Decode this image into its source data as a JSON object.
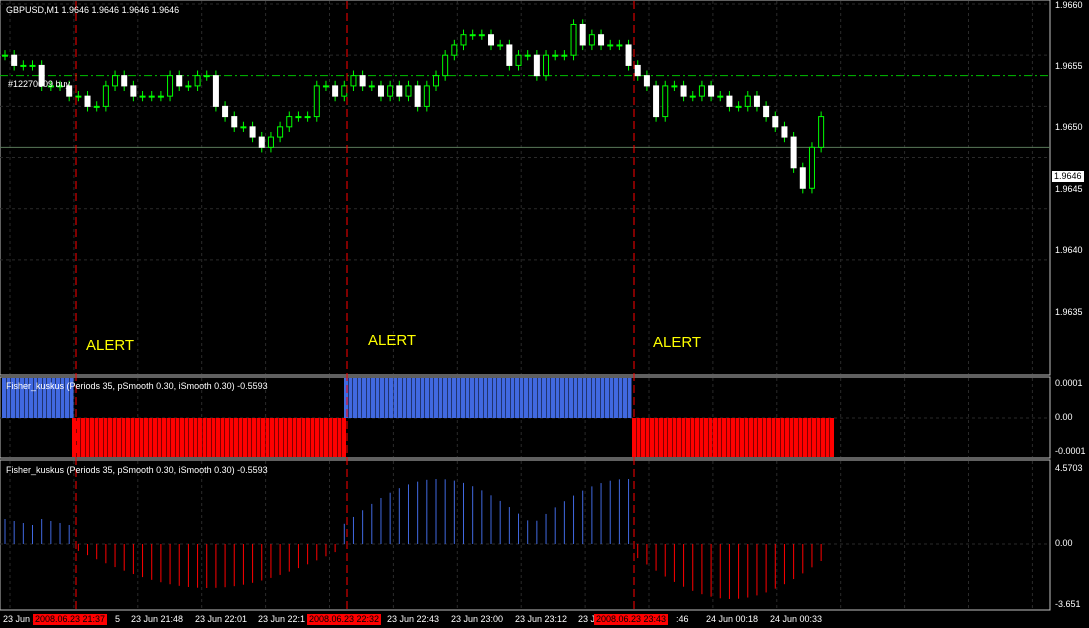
{
  "window": {
    "title": "GBPUSD,M1  1.9646 1.9646 1.9646 1.9646"
  },
  "order_label": "#12270609 buy",
  "alerts": [
    "ALERT",
    "ALERT",
    "ALERT"
  ],
  "price_axis": {
    "labels": [
      "1.9660",
      "1.9655",
      "1.9650",
      "1.9645",
      "1.9640",
      "1.9635"
    ],
    "current": "1.9646"
  },
  "ind1": {
    "title": "Fisher_kuskus  (Periods 35, pSmooth 0.30, iSmooth 0.30)  -0.5593",
    "axis": [
      "0.0001",
      "0.00",
      "-0.0001"
    ]
  },
  "ind2": {
    "title": "Fisher_kuskus  (Periods 35, pSmooth 0.30, iSmooth 0.30)  -0.5593",
    "axis": [
      "4.5703",
      "0.00",
      "-3.651"
    ]
  },
  "time_axis": {
    "labels": [
      "23 Jun 2",
      "5",
      "23 Jun 21:48",
      "23 Jun 22:01",
      "23 Jun 22:1",
      "23 Jun 22:43",
      "23 Jun 23:00",
      "23 Jun 23:12",
      "23 J",
      ":46",
      "24 Jun 00:18",
      "24 Jun 00:33"
    ],
    "markers": [
      "2008.06.23 21:37",
      "2008.06.23 22:32",
      "2008.06.23 23:43"
    ]
  },
  "colors": {
    "bull": "#00ff00",
    "bear": "#ffffff",
    "up": "#4169e1",
    "down": "#ff0000",
    "alert": "#ffff00",
    "grid": "#2a2a2a",
    "vline": "#ff0000"
  },
  "chart_data": {
    "type": "candlestick",
    "symbol": "GBPUSD",
    "timeframe": "M1",
    "price_range": [
      1.963,
      1.966
    ],
    "current_price": 1.9646,
    "order_price": 1.9653,
    "close_series": [
      1.9655,
      1.9654,
      1.9654,
      1.9654,
      1.9652,
      1.9652,
      1.9652,
      1.9651,
      1.9651,
      1.965,
      1.965,
      1.9652,
      1.9653,
      1.9652,
      1.9651,
      1.9651,
      1.9651,
      1.9651,
      1.9653,
      1.9652,
      1.9652,
      1.9653,
      1.9653,
      1.965,
      1.9649,
      1.9648,
      1.9648,
      1.9647,
      1.9646,
      1.9647,
      1.9648,
      1.9649,
      1.9649,
      1.9649,
      1.9652,
      1.9652,
      1.9651,
      1.9652,
      1.9653,
      1.9652,
      1.9652,
      1.9651,
      1.9652,
      1.9651,
      1.9652,
      1.965,
      1.9652,
      1.9653,
      1.9655,
      1.9656,
      1.9657,
      1.9657,
      1.9657,
      1.9656,
      1.9656,
      1.9654,
      1.9655,
      1.9655,
      1.9653,
      1.9655,
      1.9655,
      1.9655,
      1.9658,
      1.9656,
      1.9657,
      1.9656,
      1.9656,
      1.9656,
      1.9654,
      1.9653,
      1.9652,
      1.9649,
      1.9652,
      1.9652,
      1.9651,
      1.9651,
      1.9652,
      1.9651,
      1.9651,
      1.965,
      1.965,
      1.9651,
      1.965,
      1.9649,
      1.9648,
      1.9647,
      1.9644,
      1.9642,
      1.9646,
      1.9649
    ]
  }
}
